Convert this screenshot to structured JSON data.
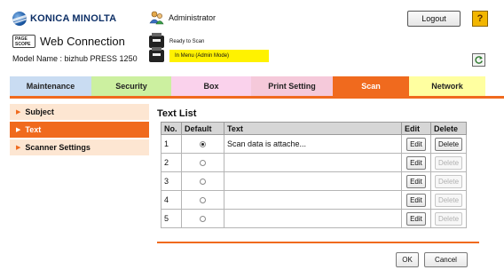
{
  "header": {
    "brand": "KONICA MINOLTA",
    "pagescope_badge": "PAGE SCOPE",
    "product": "Web Connection",
    "model_label": "Model Name : bizhub PRESS 1250",
    "user": "Administrator",
    "status_ready": "Ready to Scan",
    "status_mode": "In Menu (Admin Mode)",
    "logout_label": "Logout",
    "help_label": "?"
  },
  "tabs": [
    {
      "label": "Maintenance",
      "color": "#c9dcf2",
      "active": false
    },
    {
      "label": "Security",
      "color": "#ccf0a0",
      "active": false
    },
    {
      "label": "Box",
      "color": "#fad2ec",
      "active": false
    },
    {
      "label": "Print Setting",
      "color": "#f5c9da",
      "active": false
    },
    {
      "label": "Scan",
      "color": "#f06a1e",
      "active": true
    },
    {
      "label": "Network",
      "color": "#ffffa0",
      "active": false
    }
  ],
  "sidebar": {
    "items": [
      {
        "label": "Subject",
        "active": false
      },
      {
        "label": "Text",
        "active": true
      },
      {
        "label": "Scanner Settings",
        "active": false
      }
    ]
  },
  "main": {
    "title": "Text List",
    "columns": {
      "no": "No.",
      "default": "Default",
      "text": "Text",
      "edit": "Edit",
      "delete": "Delete"
    },
    "rows": [
      {
        "no": "1",
        "default": true,
        "text": "Scan data is attache...",
        "edit": "Edit",
        "delete": "Delete",
        "delete_enabled": true
      },
      {
        "no": "2",
        "default": false,
        "text": "",
        "edit": "Edit",
        "delete": "Delete",
        "delete_enabled": false
      },
      {
        "no": "3",
        "default": false,
        "text": "",
        "edit": "Edit",
        "delete": "Delete",
        "delete_enabled": false
      },
      {
        "no": "4",
        "default": false,
        "text": "",
        "edit": "Edit",
        "delete": "Delete",
        "delete_enabled": false
      },
      {
        "no": "5",
        "default": false,
        "text": "",
        "edit": "Edit",
        "delete": "Delete",
        "delete_enabled": false
      }
    ],
    "ok_label": "OK",
    "cancel_label": "Cancel"
  },
  "colors": {
    "accent": "#f06a1e",
    "status_highlight": "#fff200",
    "sidebar_bg": "#fde6d2"
  },
  "icons": {
    "brand": "konica-minolta-globe-icon",
    "admin": "administrator-users-icon",
    "status_ready": "scanner-icon",
    "status_mode": "printer-icon",
    "help": "help-icon",
    "refresh": "refresh-icon"
  }
}
